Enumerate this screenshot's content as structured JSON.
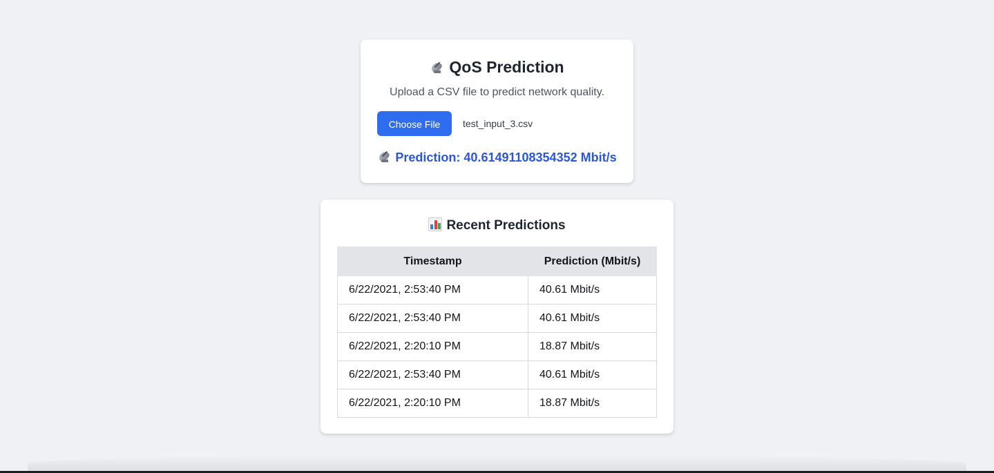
{
  "upload_card": {
    "title_icon": "satellite-antenna-icon",
    "title": "QoS Prediction",
    "subtitle": "Upload a CSV file to predict network quality.",
    "choose_button_label": "Choose File",
    "file_name": "test_input_3.csv",
    "prediction_icon": "satellite-antenna-icon",
    "prediction_text": "Prediction: 40.61491108354352 Mbit/s"
  },
  "history_card": {
    "title_icon": "bar-chart-icon",
    "title": "Recent Predictions",
    "columns": [
      "Timestamp",
      "Prediction (Mbit/s)"
    ],
    "rows": [
      {
        "timestamp": "6/22/2021, 2:53:40 PM",
        "prediction": "40.61 Mbit/s"
      },
      {
        "timestamp": "6/22/2021, 2:53:40 PM",
        "prediction": "40.61 Mbit/s"
      },
      {
        "timestamp": "6/22/2021, 2:20:10 PM",
        "prediction": "18.87 Mbit/s"
      },
      {
        "timestamp": "6/22/2021, 2:53:40 PM",
        "prediction": "40.61 Mbit/s"
      },
      {
        "timestamp": "6/22/2021, 2:20:10 PM",
        "prediction": "18.87 Mbit/s"
      }
    ]
  },
  "colors": {
    "page_background": "#f0f1f4",
    "card_background": "#ffffff",
    "button_accent": "#2f6df0",
    "prediction_text": "#2b56d6",
    "table_header_background": "#e3e4e8"
  }
}
